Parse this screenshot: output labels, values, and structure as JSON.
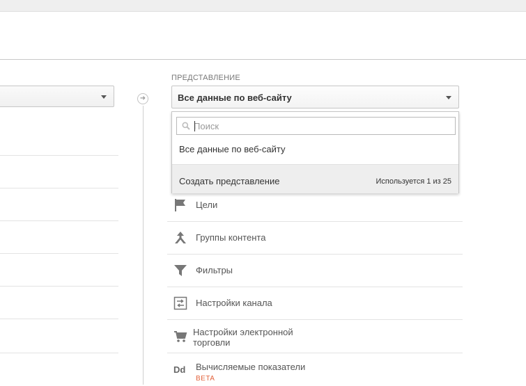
{
  "view": {
    "section_label": "ПРЕДСТАВЛЕНИЕ",
    "selected": "Все данные по веб-сайту"
  },
  "dropdown": {
    "search_placeholder": "Поиск",
    "search_value": "",
    "options": [
      "Все данные по веб-сайту"
    ],
    "create_label": "Создать представление",
    "usage_text": "Используется 1 из 25"
  },
  "menu": {
    "goals": "Цели",
    "content_groups": "Группы контента",
    "filters": "Фильтры",
    "channel_settings": "Настройки канала",
    "ecommerce_line1": "Настройки электронной",
    "ecommerce_line2": "торговли",
    "calculated_metrics": "Вычисляемые показатели",
    "beta": "BETA",
    "dd_icon_text": "Dd"
  },
  "icons": {
    "flag": "flag-icon",
    "content": "content-groups-icon",
    "filter": "filter-icon",
    "channel": "channel-settings-icon",
    "cart": "cart-icon",
    "metrics": "calculated-metrics-icon",
    "search": "search-icon",
    "arrow": "arrow-right-icon"
  },
  "colors": {
    "beta": "#e2623b",
    "footer_bg": "#eeeeee"
  }
}
